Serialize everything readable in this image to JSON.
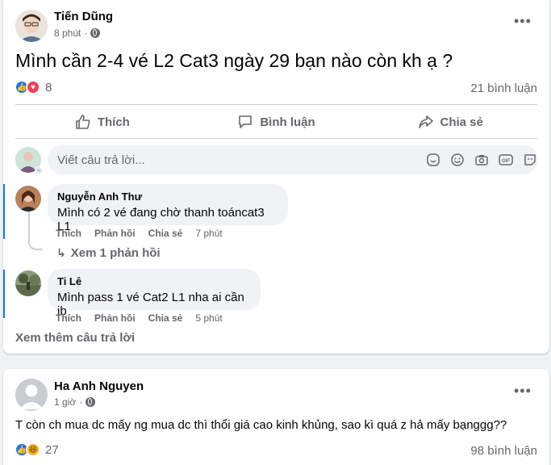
{
  "post1": {
    "author": "Tiến Dũng",
    "time": "8 phút",
    "content": "Mình cần 2-4 vé L2 Cat3 ngày 29 bạn nào còn kh ạ ?",
    "reaction_count": "8",
    "comment_count": "21 bình luận",
    "actions": {
      "like": "Thích",
      "comment": "Bình luận",
      "share": "Chia sẻ"
    },
    "reply_placeholder": "Viết câu trả lời...",
    "comments": [
      {
        "name": "Nguyễn Anh Thư",
        "text": "Mình có 2 vé đang chờ thanh toáncat3 L1",
        "like": "Thích",
        "reply": "Phản hồi",
        "share": "Chia sẻ",
        "time": "7 phút",
        "view_replies": "Xem 1 phản hồi"
      },
      {
        "name": "Ti Lê",
        "text": "Mình pass 1 vé Cat2 L1 nha ai cần ib",
        "like": "Thích",
        "reply": "Phản hồi",
        "share": "Chia sẻ",
        "time": "5 phút"
      }
    ],
    "more_replies": "Xem thêm câu trả lời"
  },
  "post2": {
    "author": "Ha Anh Nguyen",
    "time": "1 giờ",
    "content": "T còn ch mua dc mấy ng mua dc thì thổi giá cao kinh khủng, sao kì quá z hả mấy bạnggg??",
    "reaction_count": "27",
    "comment_count": "98 bình luận"
  },
  "colors": {
    "like_blue": "#1877f2",
    "love_red": "#f33e58",
    "haha_yellow": "#f7b125",
    "muted": "#65676b"
  },
  "icons": [
    "globe-icon",
    "more-icon",
    "like-icon",
    "comment-icon",
    "share-icon",
    "sticker-icon",
    "emoji-icon",
    "camera-icon",
    "gif-icon",
    "avatar-sticker-icon",
    "reply-arrow-icon"
  ]
}
